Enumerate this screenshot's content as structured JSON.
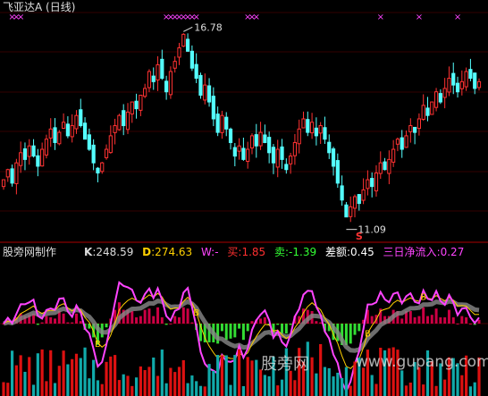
{
  "window": {
    "title": "飞亚达A (日线)",
    "indicator_name": "股旁网制作",
    "watermark_text": "股旁网",
    "watermark_url": "www.gupang.com"
  },
  "indicator_values": {
    "k_label": "K",
    "k_value": ":248.59",
    "d_label": "D",
    "d_value": ":274.63",
    "w_label": "W:",
    "w_value": "-",
    "buy_label": "买",
    "buy_value": ":1.85",
    "sell_label": "卖",
    "sell_value": ":-1.39",
    "diff_label": "差额",
    "diff_value": ":0.45",
    "net_label": "三日净流入",
    "net_value": ":0.27"
  },
  "colors": {
    "background": "#000000",
    "up": "#ff3232",
    "down": "#54ffff",
    "magenta": "#ff44ff",
    "yellow": "#ffd000",
    "green": "#33dd33",
    "crimson": "#cc0044",
    "gray": "#888888"
  },
  "chart_data": [
    {
      "type": "candlestick",
      "title": "飞亚达A (日线)",
      "annotations": {
        "high_label": "16.78",
        "low_label": "11.09",
        "top_marker_glyph": "×",
        "bottom_signal_glyph": "S"
      },
      "price_high": 16.78,
      "price_low": 11.09,
      "close_series": [
        12.4,
        12.7,
        12.3,
        12.9,
        13.2,
        13.0,
        13.4,
        13.1,
        12.8,
        13.3,
        13.6,
        13.9,
        13.5,
        13.8,
        14.1,
        13.7,
        14.0,
        14.3,
        14.0,
        13.6,
        13.3,
        12.9,
        12.6,
        12.9,
        13.3,
        13.7,
        14.0,
        14.3,
        14.0,
        14.4,
        14.7,
        14.5,
        14.9,
        15.1,
        15.6,
        15.3,
        15.8,
        15.4,
        15.0,
        15.6,
        15.9,
        16.3,
        16.7,
        16.2,
        15.7,
        15.4,
        14.9,
        15.2,
        14.7,
        14.2,
        13.8,
        14.3,
        13.9,
        13.5,
        13.1,
        13.4,
        13.0,
        13.3,
        13.7,
        13.4,
        13.8,
        13.5,
        13.2,
        12.9,
        13.3,
        13.0,
        12.7,
        13.1,
        13.5,
        13.9,
        14.2,
        13.8,
        14.1,
        13.7,
        14.0,
        13.6,
        13.2,
        12.8,
        12.3,
        11.8,
        11.3,
        11.6,
        11.9,
        11.7,
        12.1,
        12.4,
        12.2,
        12.6,
        12.9,
        12.7,
        13.0,
        13.3,
        13.6,
        13.3,
        13.7,
        14.0,
        13.8,
        14.2,
        14.6,
        14.3,
        14.7,
        15.0,
        14.7,
        15.1,
        15.4,
        15.2,
        15.0,
        15.3,
        15.6,
        15.4,
        15.1,
        15.3
      ],
      "x_marker_positions": [
        2,
        3,
        4,
        38,
        39,
        40,
        41,
        42,
        43,
        44,
        45,
        57,
        58,
        59,
        88,
        97,
        106
      ],
      "sell_signal_index": 83
    },
    {
      "type": "line",
      "title": "股旁网制作",
      "series": [
        {
          "name": "K",
          "value": 248.59
        },
        {
          "name": "D",
          "value": 274.63
        },
        {
          "name": "W",
          "value": null
        },
        {
          "name": "买",
          "value": 1.85
        },
        {
          "name": "卖",
          "value": -1.39
        },
        {
          "name": "差额",
          "value": 0.45
        },
        {
          "name": "三日净流入",
          "value": 0.27
        }
      ],
      "signal_glyph": "B",
      "buy_signal_indices": [
        22,
        45,
        85,
        98
      ]
    }
  ]
}
